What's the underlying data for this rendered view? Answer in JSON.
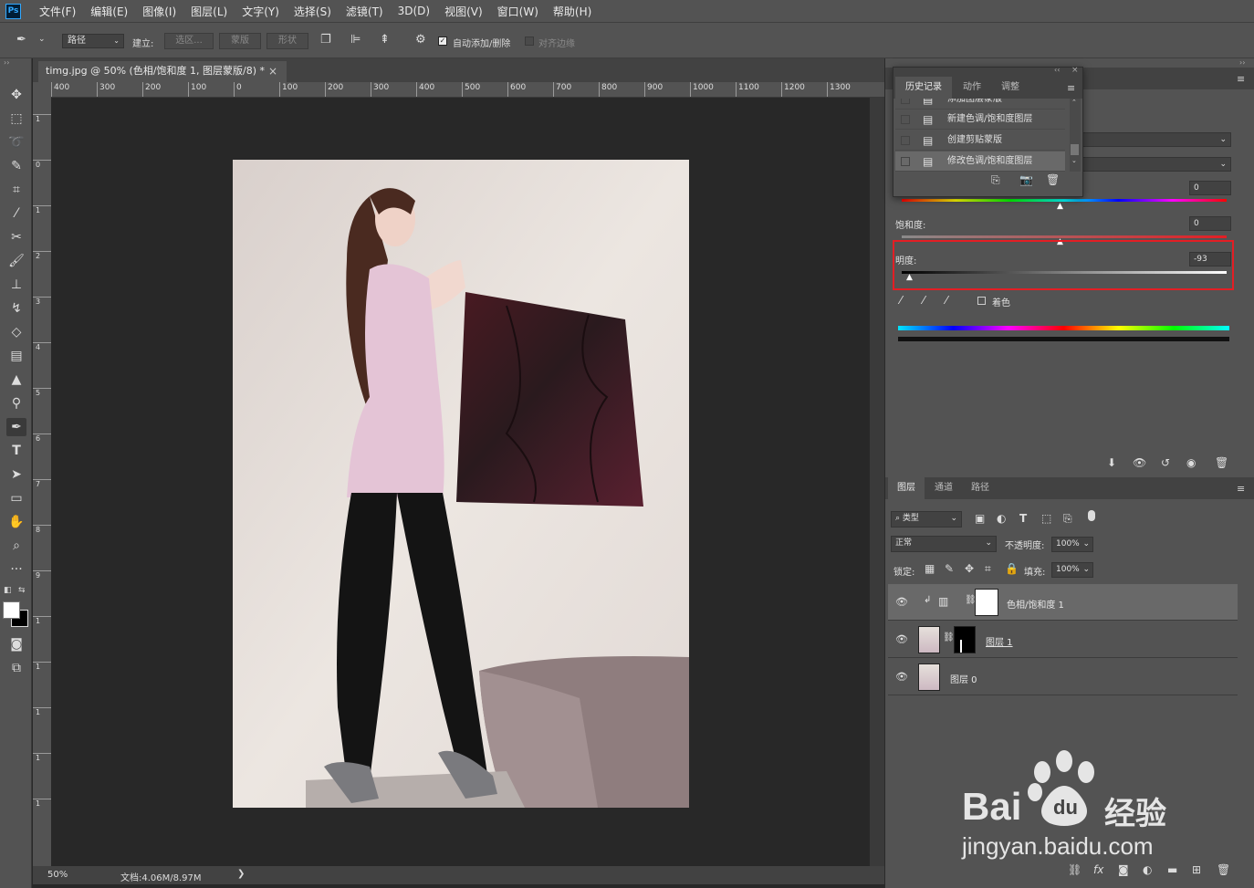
{
  "app": {
    "logo": "Ps"
  },
  "menu": [
    "文件(F)",
    "编辑(E)",
    "图像(I)",
    "图层(L)",
    "文字(Y)",
    "选择(S)",
    "滤镜(T)",
    "3D(D)",
    "视图(V)",
    "窗口(W)",
    "帮助(H)"
  ],
  "options": {
    "mode_select": "路径",
    "build_label": "建立:",
    "selection_btn": "选区...",
    "mask_btn": "蒙版",
    "shape_btn": "形状",
    "auto_add_delete": "自动添加/删除",
    "align_edges": "对齐边缘"
  },
  "document": {
    "tab_title": "timg.jpg @ 50% (色相/饱和度 1, 图层蒙版/8) *",
    "close": "×",
    "ruler_h": [
      "400",
      "300",
      "200",
      "100",
      "0",
      "100",
      "200",
      "300",
      "400",
      "500",
      "600",
      "700",
      "800",
      "900",
      "1000",
      "1100",
      "1200",
      "1300"
    ],
    "ruler_v": [
      "1",
      "0",
      "1",
      "2",
      "3",
      "4",
      "5",
      "6",
      "7",
      "8",
      "9",
      "1",
      "1",
      "1",
      "1",
      "1"
    ]
  },
  "status": {
    "zoom": "50%",
    "doc_size": "文档:4.06M/8.97M",
    "arrow": "❯"
  },
  "history": {
    "tabs": [
      "历史记录",
      "动作",
      "调整"
    ],
    "items": [
      {
        "label": "添加图层蒙版"
      },
      {
        "label": "新建色调/饱和度图层"
      },
      {
        "label": "创建剪贴蒙版"
      },
      {
        "label": "修改色调/饱和度图层"
      }
    ]
  },
  "properties": {
    "hue_value": "0",
    "saturation_label": "饱和度:",
    "saturation_value": "0",
    "lightness_label": "明度:",
    "lightness_value": "-93",
    "colorize_label": "着色"
  },
  "layers": {
    "tabs": [
      "图层",
      "通道",
      "路径"
    ],
    "filter_kind": "类型",
    "blend_mode": "正常",
    "opacity_label": "不透明度:",
    "opacity_value": "100%",
    "lock_label": "锁定:",
    "fill_label": "填充:",
    "fill_value": "100%",
    "rows": [
      {
        "name": "色相/饱和度 1"
      },
      {
        "name": "图层 1"
      },
      {
        "name": "图层 0"
      }
    ]
  },
  "watermark": {
    "brand": "Bai",
    "brand_du": "du",
    "product": "经验",
    "url": "jingyan.baidu.com"
  },
  "colors": {
    "accent_red": "#e31e24",
    "panel_bg": "#535353",
    "canvas_bg": "#282828"
  }
}
